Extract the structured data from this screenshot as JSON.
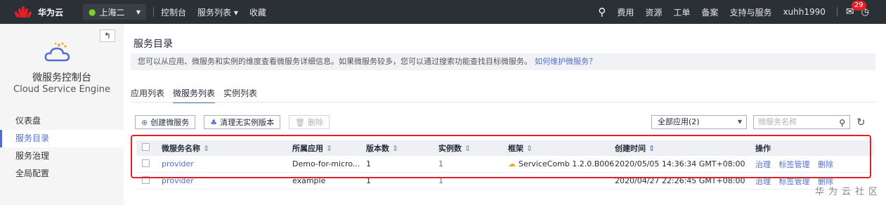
{
  "topbar": {
    "brand": "华为云",
    "region": "上海二",
    "nav": [
      "控制台",
      "服务列表 ▾",
      "收藏"
    ],
    "right_links": [
      "费用",
      "资源",
      "工单",
      "备案",
      "支持与服务",
      "xuhh1990"
    ],
    "mail_count": "29",
    "icons": [
      "search-icon",
      "mail-icon",
      "clock-icon"
    ]
  },
  "sidebar": {
    "title": "微服务控制台",
    "subtitle": "Cloud Service Engine",
    "items": [
      {
        "label": "仪表盘",
        "active": false
      },
      {
        "label": "服务目录",
        "active": true
      },
      {
        "label": "服务治理",
        "active": false
      },
      {
        "label": "全局配置",
        "active": false
      }
    ]
  },
  "main": {
    "title": "服务目录",
    "info_text": "您可以从应用、微服务和实例的维度查看微服务详细信息。如果微服务较多，您可以通过搜索功能查找目标微服务。",
    "info_link": "如何维护微服务？",
    "tabs": [
      {
        "label": "应用列表",
        "active": false
      },
      {
        "label": "微服务列表",
        "active": true
      },
      {
        "label": "实例列表",
        "active": false
      }
    ],
    "toolbar": {
      "create_label": "创建微服务",
      "clean_label": "清理无实例版本",
      "delete_label": "删除",
      "app_select_value": "全部应用(2)",
      "search_placeholder": "微服务名称"
    },
    "table": {
      "columns": [
        "微服务名称",
        "所属应用",
        "版本数",
        "实例数",
        "框架",
        "创建时间",
        "操作"
      ],
      "rows": [
        {
          "name": "provider",
          "app": "Demo-for-micro...",
          "versions": "1",
          "instances": "1",
          "framework": "ServiceComb 1.2.0.B006",
          "created": "2020/05/05 14:36:34 GMT+08:00",
          "ops": [
            "治理",
            "标签管理",
            "删除"
          ]
        },
        {
          "name": "provider",
          "app": "example",
          "versions": "1",
          "instances": "1",
          "framework": "",
          "created": "2020/04/27 22:26:45 GMT+08:00",
          "ops": [
            "治理",
            "标签管理",
            "删除"
          ]
        }
      ]
    }
  },
  "watermark": "华为云社区",
  "colors": {
    "accent": "#526ecc",
    "brand_red": "#e02128",
    "topbar_bg": "#2b2f36"
  }
}
